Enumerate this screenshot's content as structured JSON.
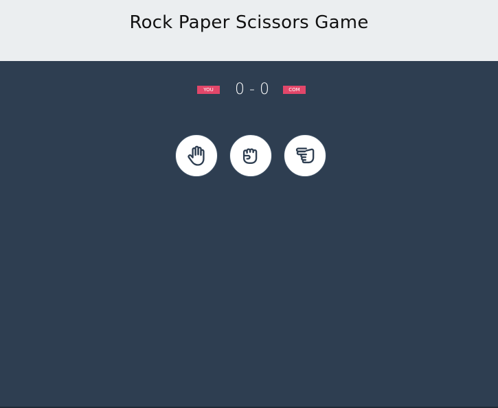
{
  "header": {
    "title": "Rock Paper Scissors Game"
  },
  "scoreboard": {
    "user_label": "YOU",
    "computer_label": "COM",
    "user_score": "0",
    "separator": "-",
    "computer_score": "0",
    "badge_color": "#e2476a"
  },
  "choices": [
    {
      "name": "paper",
      "icon": "hand-paper-icon"
    },
    {
      "name": "rock",
      "icon": "hand-rock-icon"
    },
    {
      "name": "scissors",
      "icon": "hand-scissors-icon"
    }
  ],
  "colors": {
    "background": "#2e3e51",
    "header_background": "#ebeef0",
    "accent": "#e2476a",
    "icon_stroke": "#2e3e51"
  }
}
